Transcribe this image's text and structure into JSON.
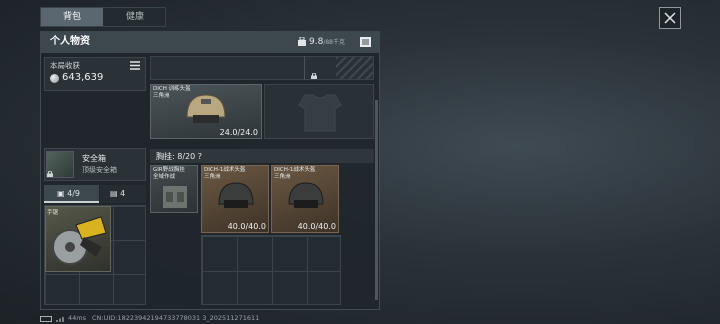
{
  "tabs": {
    "backpack": "背包",
    "health": "健康"
  },
  "header": {
    "title": "个人物资",
    "weight_value": "9.8",
    "weight_max": "/88千克"
  },
  "income": {
    "label": "本局收获",
    "value": "643,639"
  },
  "safe": {
    "name": "安全箱",
    "subtitle": "顶级安全箱"
  },
  "subtabs": {
    "bag_count": "4/9",
    "vest_count": "4"
  },
  "tool": {
    "label": "手锯"
  },
  "helmet_top": {
    "name": "DICH 训练头盔",
    "sub": "三角洲",
    "durability": "24.0/24.0"
  },
  "chest": {
    "label": "胸挂: 8/20  ?"
  },
  "rig": {
    "name": "GIR野战胸挂",
    "sub": "全域作战"
  },
  "helmet_a": {
    "name": "DICH-1战术头盔",
    "sub": "三角洲",
    "durability": "40.0/40.0"
  },
  "helmet_b": {
    "name": "DICH-1战术头盔",
    "sub": "三角洲",
    "durability": "40.0/40.0"
  },
  "footer": {
    "ping": "44ms",
    "uid": "CN:UID:18223942194733778031 3_202511271611"
  },
  "icons": {
    "close": "close-icon",
    "weight": "weight-icon",
    "list": "list-icon",
    "coin": "coin-icon",
    "lock": "lock-icon"
  }
}
